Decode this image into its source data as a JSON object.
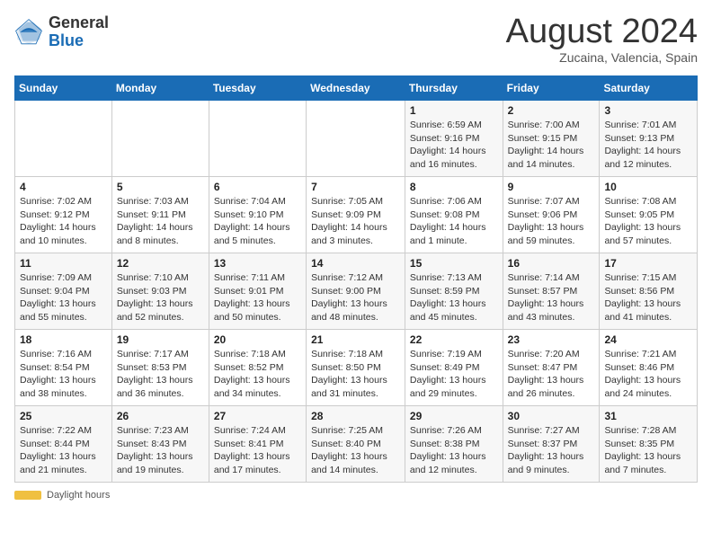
{
  "header": {
    "logo_general": "General",
    "logo_blue": "Blue",
    "month_year": "August 2024",
    "location": "Zucaina, Valencia, Spain"
  },
  "days_of_week": [
    "Sunday",
    "Monday",
    "Tuesday",
    "Wednesday",
    "Thursday",
    "Friday",
    "Saturday"
  ],
  "weeks": [
    [
      {
        "day": "",
        "info": ""
      },
      {
        "day": "",
        "info": ""
      },
      {
        "day": "",
        "info": ""
      },
      {
        "day": "",
        "info": ""
      },
      {
        "day": "1",
        "info": "Sunrise: 6:59 AM\nSunset: 9:16 PM\nDaylight: 14 hours\nand 16 minutes."
      },
      {
        "day": "2",
        "info": "Sunrise: 7:00 AM\nSunset: 9:15 PM\nDaylight: 14 hours\nand 14 minutes."
      },
      {
        "day": "3",
        "info": "Sunrise: 7:01 AM\nSunset: 9:13 PM\nDaylight: 14 hours\nand 12 minutes."
      }
    ],
    [
      {
        "day": "4",
        "info": "Sunrise: 7:02 AM\nSunset: 9:12 PM\nDaylight: 14 hours\nand 10 minutes."
      },
      {
        "day": "5",
        "info": "Sunrise: 7:03 AM\nSunset: 9:11 PM\nDaylight: 14 hours\nand 8 minutes."
      },
      {
        "day": "6",
        "info": "Sunrise: 7:04 AM\nSunset: 9:10 PM\nDaylight: 14 hours\nand 5 minutes."
      },
      {
        "day": "7",
        "info": "Sunrise: 7:05 AM\nSunset: 9:09 PM\nDaylight: 14 hours\nand 3 minutes."
      },
      {
        "day": "8",
        "info": "Sunrise: 7:06 AM\nSunset: 9:08 PM\nDaylight: 14 hours\nand 1 minute."
      },
      {
        "day": "9",
        "info": "Sunrise: 7:07 AM\nSunset: 9:06 PM\nDaylight: 13 hours\nand 59 minutes."
      },
      {
        "day": "10",
        "info": "Sunrise: 7:08 AM\nSunset: 9:05 PM\nDaylight: 13 hours\nand 57 minutes."
      }
    ],
    [
      {
        "day": "11",
        "info": "Sunrise: 7:09 AM\nSunset: 9:04 PM\nDaylight: 13 hours\nand 55 minutes."
      },
      {
        "day": "12",
        "info": "Sunrise: 7:10 AM\nSunset: 9:03 PM\nDaylight: 13 hours\nand 52 minutes."
      },
      {
        "day": "13",
        "info": "Sunrise: 7:11 AM\nSunset: 9:01 PM\nDaylight: 13 hours\nand 50 minutes."
      },
      {
        "day": "14",
        "info": "Sunrise: 7:12 AM\nSunset: 9:00 PM\nDaylight: 13 hours\nand 48 minutes."
      },
      {
        "day": "15",
        "info": "Sunrise: 7:13 AM\nSunset: 8:59 PM\nDaylight: 13 hours\nand 45 minutes."
      },
      {
        "day": "16",
        "info": "Sunrise: 7:14 AM\nSunset: 8:57 PM\nDaylight: 13 hours\nand 43 minutes."
      },
      {
        "day": "17",
        "info": "Sunrise: 7:15 AM\nSunset: 8:56 PM\nDaylight: 13 hours\nand 41 minutes."
      }
    ],
    [
      {
        "day": "18",
        "info": "Sunrise: 7:16 AM\nSunset: 8:54 PM\nDaylight: 13 hours\nand 38 minutes."
      },
      {
        "day": "19",
        "info": "Sunrise: 7:17 AM\nSunset: 8:53 PM\nDaylight: 13 hours\nand 36 minutes."
      },
      {
        "day": "20",
        "info": "Sunrise: 7:18 AM\nSunset: 8:52 PM\nDaylight: 13 hours\nand 34 minutes."
      },
      {
        "day": "21",
        "info": "Sunrise: 7:18 AM\nSunset: 8:50 PM\nDaylight: 13 hours\nand 31 minutes."
      },
      {
        "day": "22",
        "info": "Sunrise: 7:19 AM\nSunset: 8:49 PM\nDaylight: 13 hours\nand 29 minutes."
      },
      {
        "day": "23",
        "info": "Sunrise: 7:20 AM\nSunset: 8:47 PM\nDaylight: 13 hours\nand 26 minutes."
      },
      {
        "day": "24",
        "info": "Sunrise: 7:21 AM\nSunset: 8:46 PM\nDaylight: 13 hours\nand 24 minutes."
      }
    ],
    [
      {
        "day": "25",
        "info": "Sunrise: 7:22 AM\nSunset: 8:44 PM\nDaylight: 13 hours\nand 21 minutes."
      },
      {
        "day": "26",
        "info": "Sunrise: 7:23 AM\nSunset: 8:43 PM\nDaylight: 13 hours\nand 19 minutes."
      },
      {
        "day": "27",
        "info": "Sunrise: 7:24 AM\nSunset: 8:41 PM\nDaylight: 13 hours\nand 17 minutes."
      },
      {
        "day": "28",
        "info": "Sunrise: 7:25 AM\nSunset: 8:40 PM\nDaylight: 13 hours\nand 14 minutes."
      },
      {
        "day": "29",
        "info": "Sunrise: 7:26 AM\nSunset: 8:38 PM\nDaylight: 13 hours\nand 12 minutes."
      },
      {
        "day": "30",
        "info": "Sunrise: 7:27 AM\nSunset: 8:37 PM\nDaylight: 13 hours\nand 9 minutes."
      },
      {
        "day": "31",
        "info": "Sunrise: 7:28 AM\nSunset: 8:35 PM\nDaylight: 13 hours\nand 7 minutes."
      }
    ]
  ],
  "footer": {
    "daylight_label": "Daylight hours"
  }
}
